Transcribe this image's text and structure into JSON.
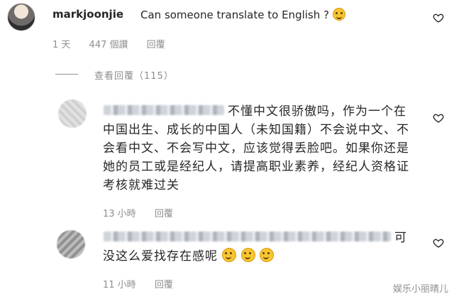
{
  "main_comment": {
    "username": "markjoonjie",
    "text": "Can someone translate to English ?",
    "time": "1 天",
    "likes": "447 個讚",
    "reply": "回覆"
  },
  "view_replies": {
    "label": "查看回覆（115）"
  },
  "replies": [
    {
      "text_lines": [
        "不懂中文很骄傲吗，作为一个在",
        "中国出生、成长的中国人（未知国籍）不会说中文、不",
        "会看中文、不会写中文，应该觉得丢脸吧。如果你还是",
        "她的员工或是经纪人，请提高职业素养，经纪人资格证",
        "考核就难过关"
      ],
      "time": "13 小時",
      "reply": "回覆"
    },
    {
      "text_lines": [
        "可",
        "没这么爱找存在感呢"
      ],
      "time": "11 小時",
      "reply": "回覆"
    }
  ],
  "watermark": "娱乐小丽晴儿",
  "icons": {
    "heart": "heart-outline-icon",
    "emoji_laugh": "laughing-emoji-icon",
    "emoji_smile": "smiling-emoji-icon"
  },
  "colors": {
    "text": "#262626",
    "secondary": "#8e8e8e",
    "emoji": "#f7c531"
  }
}
